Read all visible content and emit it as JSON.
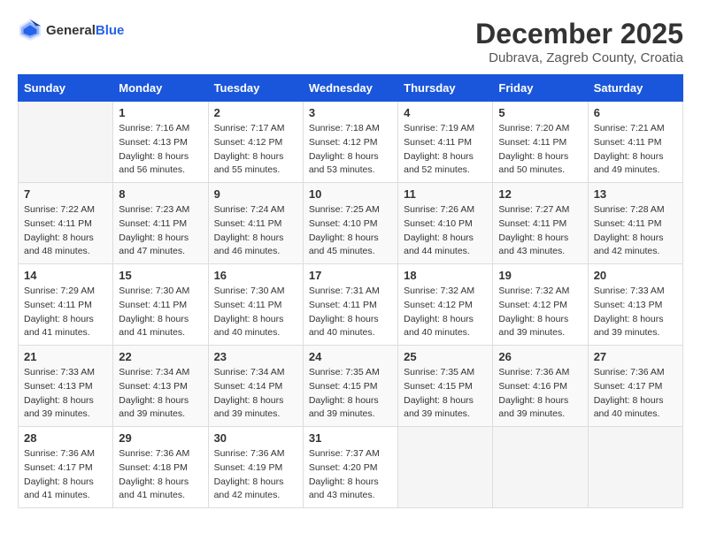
{
  "header": {
    "logo_general": "General",
    "logo_blue": "Blue",
    "month_title": "December 2025",
    "location": "Dubrava, Zagreb County, Croatia"
  },
  "calendar": {
    "days_of_week": [
      "Sunday",
      "Monday",
      "Tuesday",
      "Wednesday",
      "Thursday",
      "Friday",
      "Saturday"
    ],
    "weeks": [
      [
        {
          "day": "",
          "sunrise": "",
          "sunset": "",
          "daylight": ""
        },
        {
          "day": "1",
          "sunrise": "Sunrise: 7:16 AM",
          "sunset": "Sunset: 4:13 PM",
          "daylight": "Daylight: 8 hours and 56 minutes."
        },
        {
          "day": "2",
          "sunrise": "Sunrise: 7:17 AM",
          "sunset": "Sunset: 4:12 PM",
          "daylight": "Daylight: 8 hours and 55 minutes."
        },
        {
          "day": "3",
          "sunrise": "Sunrise: 7:18 AM",
          "sunset": "Sunset: 4:12 PM",
          "daylight": "Daylight: 8 hours and 53 minutes."
        },
        {
          "day": "4",
          "sunrise": "Sunrise: 7:19 AM",
          "sunset": "Sunset: 4:11 PM",
          "daylight": "Daylight: 8 hours and 52 minutes."
        },
        {
          "day": "5",
          "sunrise": "Sunrise: 7:20 AM",
          "sunset": "Sunset: 4:11 PM",
          "daylight": "Daylight: 8 hours and 50 minutes."
        },
        {
          "day": "6",
          "sunrise": "Sunrise: 7:21 AM",
          "sunset": "Sunset: 4:11 PM",
          "daylight": "Daylight: 8 hours and 49 minutes."
        }
      ],
      [
        {
          "day": "7",
          "sunrise": "Sunrise: 7:22 AM",
          "sunset": "Sunset: 4:11 PM",
          "daylight": "Daylight: 8 hours and 48 minutes."
        },
        {
          "day": "8",
          "sunrise": "Sunrise: 7:23 AM",
          "sunset": "Sunset: 4:11 PM",
          "daylight": "Daylight: 8 hours and 47 minutes."
        },
        {
          "day": "9",
          "sunrise": "Sunrise: 7:24 AM",
          "sunset": "Sunset: 4:11 PM",
          "daylight": "Daylight: 8 hours and 46 minutes."
        },
        {
          "day": "10",
          "sunrise": "Sunrise: 7:25 AM",
          "sunset": "Sunset: 4:10 PM",
          "daylight": "Daylight: 8 hours and 45 minutes."
        },
        {
          "day": "11",
          "sunrise": "Sunrise: 7:26 AM",
          "sunset": "Sunset: 4:10 PM",
          "daylight": "Daylight: 8 hours and 44 minutes."
        },
        {
          "day": "12",
          "sunrise": "Sunrise: 7:27 AM",
          "sunset": "Sunset: 4:11 PM",
          "daylight": "Daylight: 8 hours and 43 minutes."
        },
        {
          "day": "13",
          "sunrise": "Sunrise: 7:28 AM",
          "sunset": "Sunset: 4:11 PM",
          "daylight": "Daylight: 8 hours and 42 minutes."
        }
      ],
      [
        {
          "day": "14",
          "sunrise": "Sunrise: 7:29 AM",
          "sunset": "Sunset: 4:11 PM",
          "daylight": "Daylight: 8 hours and 41 minutes."
        },
        {
          "day": "15",
          "sunrise": "Sunrise: 7:30 AM",
          "sunset": "Sunset: 4:11 PM",
          "daylight": "Daylight: 8 hours and 41 minutes."
        },
        {
          "day": "16",
          "sunrise": "Sunrise: 7:30 AM",
          "sunset": "Sunset: 4:11 PM",
          "daylight": "Daylight: 8 hours and 40 minutes."
        },
        {
          "day": "17",
          "sunrise": "Sunrise: 7:31 AM",
          "sunset": "Sunset: 4:11 PM",
          "daylight": "Daylight: 8 hours and 40 minutes."
        },
        {
          "day": "18",
          "sunrise": "Sunrise: 7:32 AM",
          "sunset": "Sunset: 4:12 PM",
          "daylight": "Daylight: 8 hours and 40 minutes."
        },
        {
          "day": "19",
          "sunrise": "Sunrise: 7:32 AM",
          "sunset": "Sunset: 4:12 PM",
          "daylight": "Daylight: 8 hours and 39 minutes."
        },
        {
          "day": "20",
          "sunrise": "Sunrise: 7:33 AM",
          "sunset": "Sunset: 4:13 PM",
          "daylight": "Daylight: 8 hours and 39 minutes."
        }
      ],
      [
        {
          "day": "21",
          "sunrise": "Sunrise: 7:33 AM",
          "sunset": "Sunset: 4:13 PM",
          "daylight": "Daylight: 8 hours and 39 minutes."
        },
        {
          "day": "22",
          "sunrise": "Sunrise: 7:34 AM",
          "sunset": "Sunset: 4:13 PM",
          "daylight": "Daylight: 8 hours and 39 minutes."
        },
        {
          "day": "23",
          "sunrise": "Sunrise: 7:34 AM",
          "sunset": "Sunset: 4:14 PM",
          "daylight": "Daylight: 8 hours and 39 minutes."
        },
        {
          "day": "24",
          "sunrise": "Sunrise: 7:35 AM",
          "sunset": "Sunset: 4:15 PM",
          "daylight": "Daylight: 8 hours and 39 minutes."
        },
        {
          "day": "25",
          "sunrise": "Sunrise: 7:35 AM",
          "sunset": "Sunset: 4:15 PM",
          "daylight": "Daylight: 8 hours and 39 minutes."
        },
        {
          "day": "26",
          "sunrise": "Sunrise: 7:36 AM",
          "sunset": "Sunset: 4:16 PM",
          "daylight": "Daylight: 8 hours and 39 minutes."
        },
        {
          "day": "27",
          "sunrise": "Sunrise: 7:36 AM",
          "sunset": "Sunset: 4:17 PM",
          "daylight": "Daylight: 8 hours and 40 minutes."
        }
      ],
      [
        {
          "day": "28",
          "sunrise": "Sunrise: 7:36 AM",
          "sunset": "Sunset: 4:17 PM",
          "daylight": "Daylight: 8 hours and 41 minutes."
        },
        {
          "day": "29",
          "sunrise": "Sunrise: 7:36 AM",
          "sunset": "Sunset: 4:18 PM",
          "daylight": "Daylight: 8 hours and 41 minutes."
        },
        {
          "day": "30",
          "sunrise": "Sunrise: 7:36 AM",
          "sunset": "Sunset: 4:19 PM",
          "daylight": "Daylight: 8 hours and 42 minutes."
        },
        {
          "day": "31",
          "sunrise": "Sunrise: 7:37 AM",
          "sunset": "Sunset: 4:20 PM",
          "daylight": "Daylight: 8 hours and 43 minutes."
        },
        {
          "day": "",
          "sunrise": "",
          "sunset": "",
          "daylight": ""
        },
        {
          "day": "",
          "sunrise": "",
          "sunset": "",
          "daylight": ""
        },
        {
          "day": "",
          "sunrise": "",
          "sunset": "",
          "daylight": ""
        }
      ]
    ]
  }
}
